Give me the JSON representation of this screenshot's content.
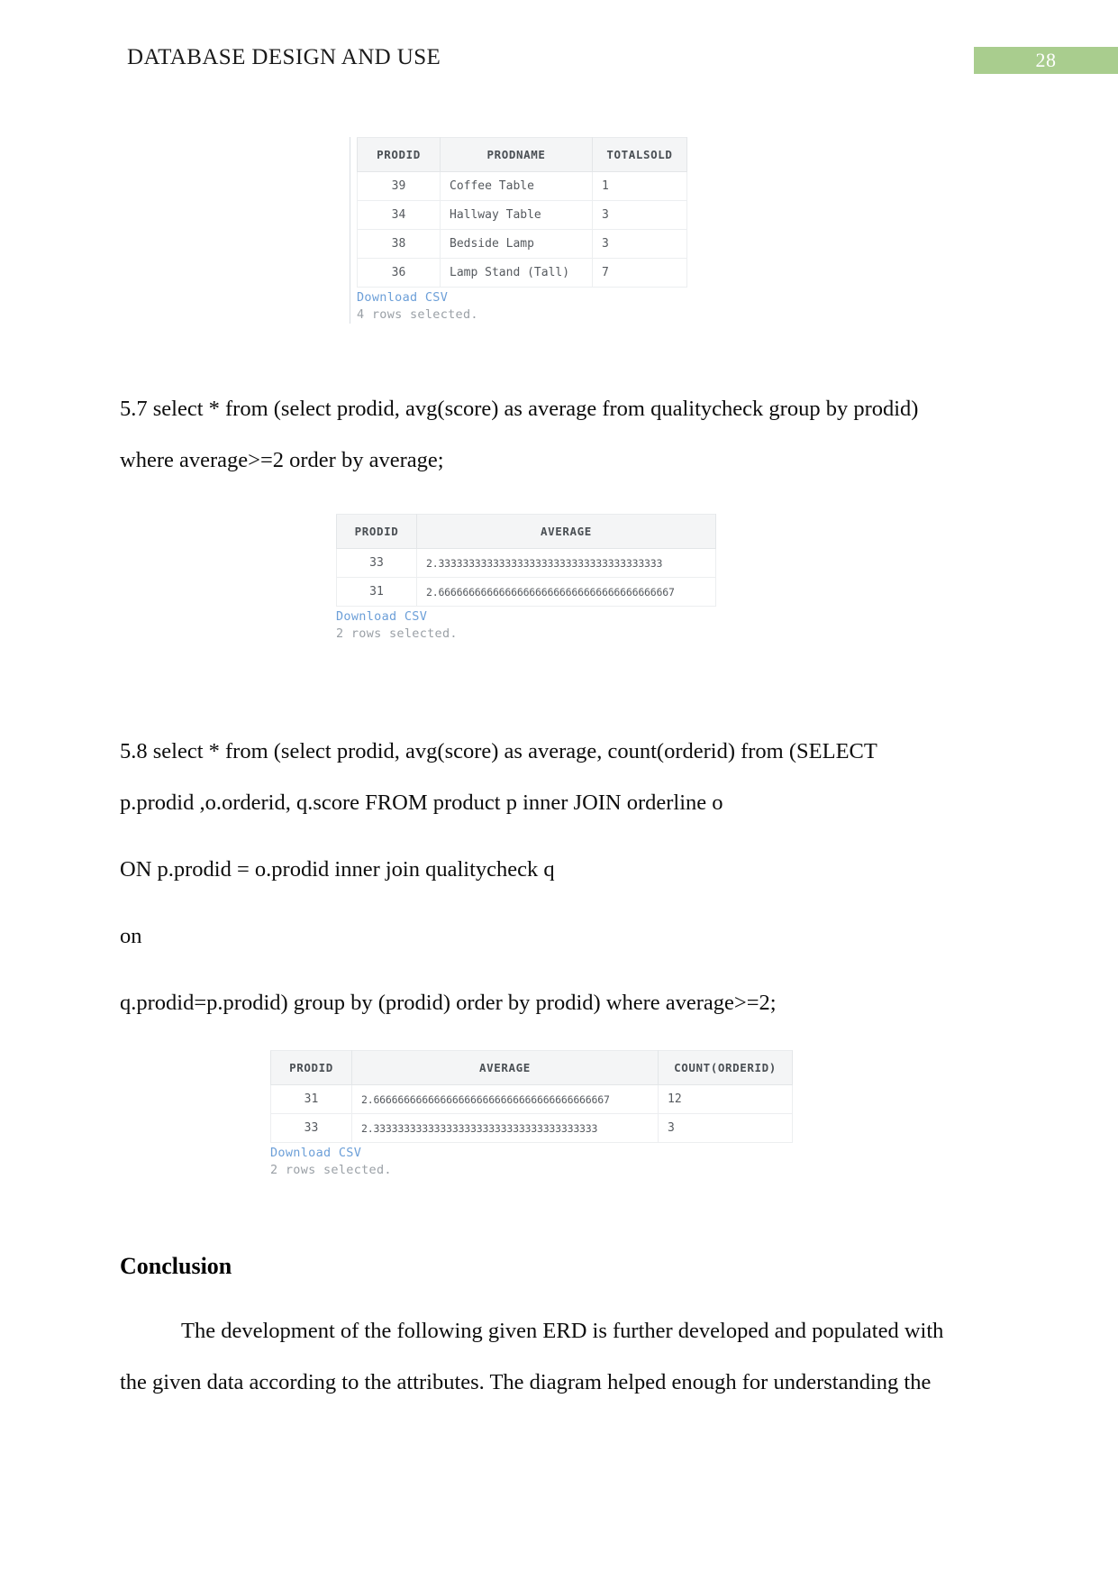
{
  "header": {
    "title": "DATABASE DESIGN AND USE",
    "page_number": "28",
    "badge_color": "#a9cd8e"
  },
  "results": {
    "query_57_prev": {
      "columns": [
        "PRODID",
        "PRODNAME",
        "TOTALSOLD"
      ],
      "rows": [
        [
          "39",
          "Coffee Table",
          "1"
        ],
        [
          "34",
          "Hallway Table",
          "3"
        ],
        [
          "38",
          "Bedside Lamp",
          "3"
        ],
        [
          "36",
          "Lamp Stand (Tall)",
          "7"
        ]
      ],
      "download_label": "Download CSV",
      "row_count_text": "4 rows selected."
    },
    "query_57": {
      "columns": [
        "PRODID",
        "AVERAGE"
      ],
      "rows": [
        [
          "33",
          "2.3333333333333333333333333333333333333"
        ],
        [
          "31",
          "2.666666666666666666666666666666666666667"
        ]
      ],
      "download_label": "Download CSV",
      "row_count_text": "2 rows selected."
    },
    "query_58": {
      "columns": [
        "PRODID",
        "AVERAGE",
        "COUNT(ORDERID)"
      ],
      "rows": [
        [
          "31",
          "2.666666666666666666666666666666666666667",
          "12"
        ],
        [
          "33",
          "2.3333333333333333333333333333333333333",
          "3"
        ]
      ],
      "download_label": "Download CSV",
      "row_count_text": "2 rows selected."
    }
  },
  "body": {
    "q57_line1": "5.7 select * from (select prodid, avg(score) as average from qualitycheck group by prodid)",
    "q57_line2": "where average>=2 order by average;",
    "q58_line1": "5.8 select * from (select prodid, avg(score) as average, count(orderid) from (SELECT",
    "q58_line2": "p.prodid ,o.orderid, q.score FROM product p inner JOIN orderline o",
    "q58_line3": "ON p.prodid = o.prodid inner join qualitycheck q",
    "q58_line4": "on",
    "q58_line5": "q.prodid=p.prodid) group by (prodid) order by prodid) where average>=2;",
    "conclusion_heading": "Conclusion",
    "conclusion_line1": "The development of the following given ERD is further developed and populated with",
    "conclusion_line2": "the given data according to the attributes. The diagram helped enough for understanding the"
  }
}
